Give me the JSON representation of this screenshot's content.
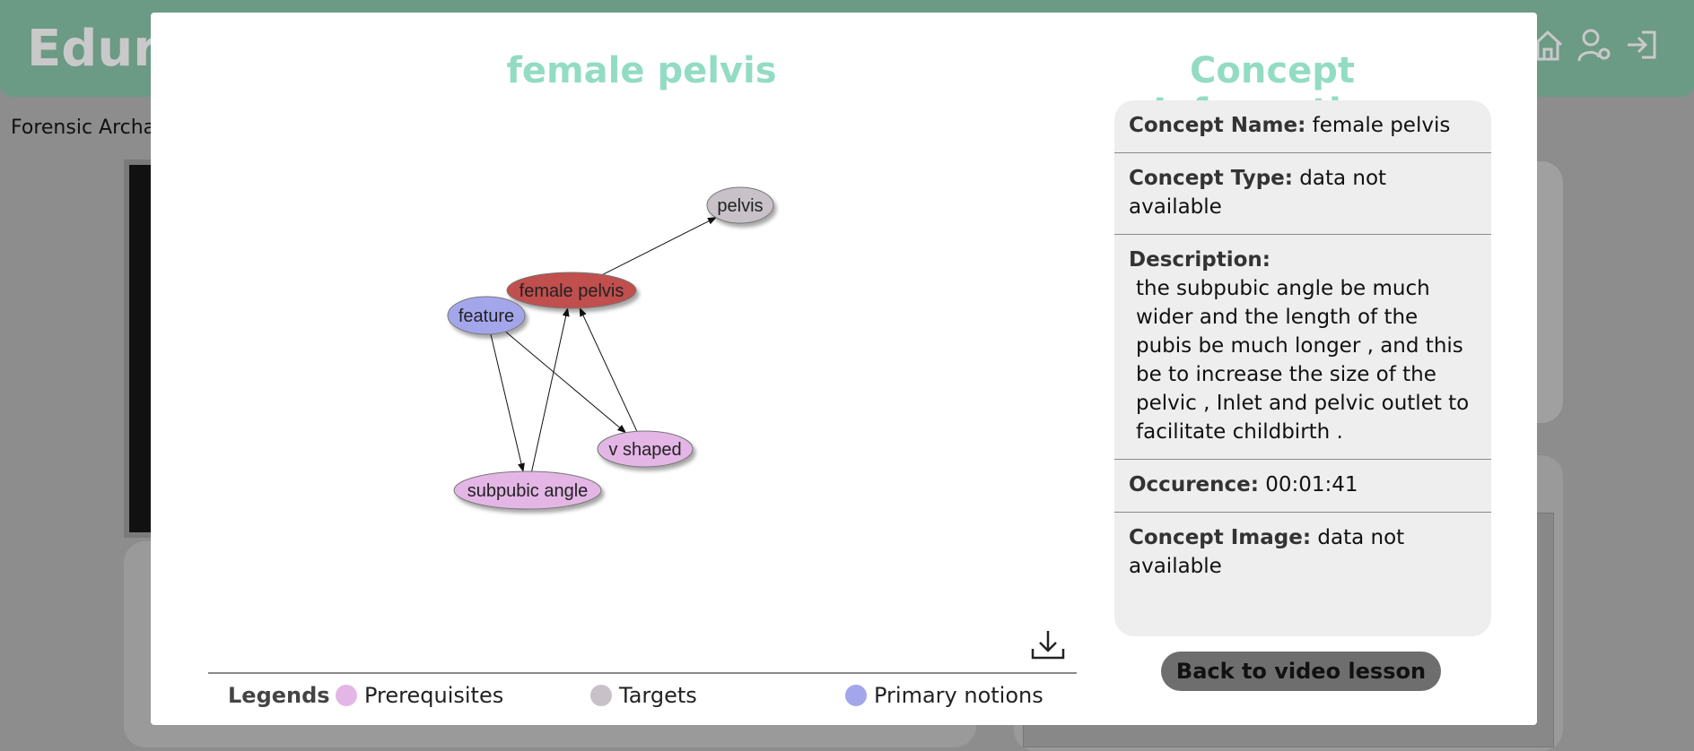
{
  "app": {
    "logo_text": "Edure",
    "breadcrumb": "Forensic Archa"
  },
  "modal": {
    "graph_title": "female pelvis",
    "graph": {
      "nodes": [
        {
          "id": "pelvis",
          "label": "pelvis",
          "role": "target",
          "color": "#c8c2c8"
        },
        {
          "id": "female_pelvis",
          "label": "female pelvis",
          "role": "current",
          "color": "#c0504d"
        },
        {
          "id": "feature",
          "label": "feature",
          "role": "primary",
          "color": "#a4a6ec"
        },
        {
          "id": "v_shaped",
          "label": "v shaped",
          "role": "prerequisite",
          "color": "#e4b6e6"
        },
        {
          "id": "subpubic_angle",
          "label": "subpubic angle",
          "role": "prerequisite",
          "color": "#e4b6e6"
        }
      ],
      "edges": [
        {
          "from": "female_pelvis",
          "to": "pelvis"
        },
        {
          "from": "feature",
          "to": "v_shaped"
        },
        {
          "from": "feature",
          "to": "subpubic_angle"
        },
        {
          "from": "subpubic_angle",
          "to": "female_pelvis"
        },
        {
          "from": "v_shaped",
          "to": "female_pelvis"
        }
      ]
    },
    "download_icon": "download-icon",
    "legends": {
      "title": "Legends",
      "items": [
        {
          "label": "Prerequisites",
          "color": "#e4b6e6"
        },
        {
          "label": "Targets",
          "color": "#c8c2c8"
        },
        {
          "label": "Primary notions",
          "color": "#a4a6ec"
        }
      ]
    },
    "info_title": "Concept Information",
    "info": {
      "name_label": "Concept Name:",
      "name_value": "female pelvis",
      "type_label": "Concept Type:",
      "type_value": "data not available",
      "description_label": "Description:",
      "description_value": "the subpubic angle be much wider and the length of the pubis be much longer , and this be to increase the size of the pelvic , Inlet and pelvic outlet to facilitate childbirth .",
      "occurence_label": "Occurence:",
      "occurence_value": "00:01:41",
      "image_label": "Concept Image:",
      "image_value": "data not available"
    },
    "back_button": "Back to video lesson"
  }
}
